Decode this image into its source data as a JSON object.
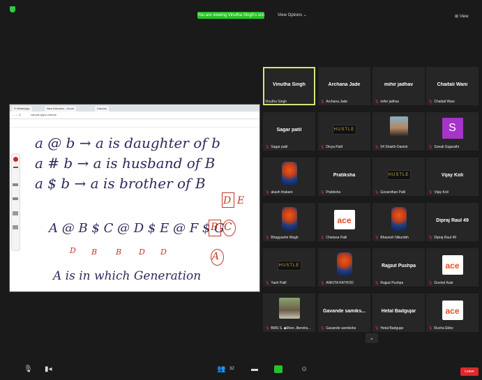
{
  "topbar": {
    "banner": "You are viewing Vinutha Singh's screen",
    "view_options": "View Options ⌄",
    "view_button": "⊞ View"
  },
  "shared_screen": {
    "tabs": [
      "© WhatsApp",
      "New Interview - Zoom",
      "Canvas"
    ],
    "address": "canvas.apps.chrome",
    "lines": [
      "a @ b → a is daughter of b",
      "a # b → a is husband of B",
      "a $ b → a is brother of B",
      "A @ B $ C @ D $ E @ F $ G",
      "A is in which Generation"
    ],
    "red_marks": [
      "D",
      "B",
      "B",
      "D",
      "D",
      "B",
      "C",
      "A",
      "D",
      "E"
    ]
  },
  "gallery": [
    {
      "name": "Vinutha Singh",
      "label": "Vinutha Singh",
      "active": true,
      "muted": false,
      "thumb": "none"
    },
    {
      "name": "Archana Jade",
      "label": "Archana Jade",
      "muted": true,
      "thumb": "none"
    },
    {
      "name": "mihir jadhav",
      "label": "mihir jadhav",
      "muted": true,
      "thumb": "none"
    },
    {
      "name": "Chaitali Wani",
      "label": "Chaitali Wani",
      "muted": true,
      "thumb": "none"
    },
    {
      "name": "Sagar patil",
      "label": "Sagar patil",
      "muted": true,
      "thumb": "none"
    },
    {
      "name": "",
      "label": "Divya Patil",
      "muted": true,
      "thumb": "hustle",
      "thumb_text": "HUSTLE"
    },
    {
      "name": "",
      "label": "54 Shaikh Danish",
      "muted": true,
      "thumb": "face"
    },
    {
      "name": "",
      "label": "Sonali Gujarathi",
      "muted": true,
      "thumb": "avatar",
      "thumb_text": "S"
    },
    {
      "name": "",
      "label": "akash thakare",
      "muted": true,
      "thumb": "logo"
    },
    {
      "name": "Pratiksha",
      "label": "Pratiksha",
      "muted": true,
      "thumb": "none"
    },
    {
      "name": "",
      "label": "Govardhan Patil",
      "muted": true,
      "thumb": "hustle",
      "thumb_text": "HUSTLE"
    },
    {
      "name": "Vijay Koli",
      "label": "Vijay Koli",
      "muted": true,
      "thumb": "none"
    },
    {
      "name": "",
      "label": "Bhagyashri Wagh",
      "muted": true,
      "thumb": "logo"
    },
    {
      "name": "",
      "label": "Chetana Patil",
      "muted": true,
      "thumb": "ace",
      "thumb_text": "ace"
    },
    {
      "name": "",
      "label": "Bhavesh Nikumbh",
      "muted": true,
      "thumb": "logo"
    },
    {
      "name": "Dipraj Raul 49",
      "label": "Dipraj Raul 49",
      "muted": true,
      "thumb": "none"
    },
    {
      "name": "",
      "label": "Yash Patil",
      "muted": true,
      "thumb": "hustle",
      "thumb_text": "HUSTLE"
    },
    {
      "name": "",
      "label": "ANKITA RATHOD",
      "muted": true,
      "thumb": "logo"
    },
    {
      "name": "Rajput Pushpa",
      "label": "Rajput Pushpa",
      "muted": true,
      "thumb": "none"
    },
    {
      "name": "",
      "label": "Govind Kale",
      "muted": true,
      "thumb": "ace",
      "thumb_text": "ace"
    },
    {
      "name": "",
      "label": "BMS S. ◆More Jitendra...",
      "muted": true,
      "thumb": "photo"
    },
    {
      "name": "Gavande samiks...",
      "label": "Gavande samiksha",
      "muted": true,
      "thumb": "none"
    },
    {
      "name": "Hetal Badgujar",
      "label": "Hetal Badgujar",
      "muted": true,
      "thumb": "none"
    },
    {
      "name": "",
      "label": "Rucha Ekbo",
      "muted": true,
      "thumb": "ace",
      "thumb_text": "ace"
    }
  ],
  "bottom": {
    "participants_count": "32",
    "leave": "Leave"
  },
  "colors": {
    "active_outline": "#d6e57a",
    "banner": "#27c227",
    "leave": "#e02828",
    "mic_muted": "#e53935"
  }
}
